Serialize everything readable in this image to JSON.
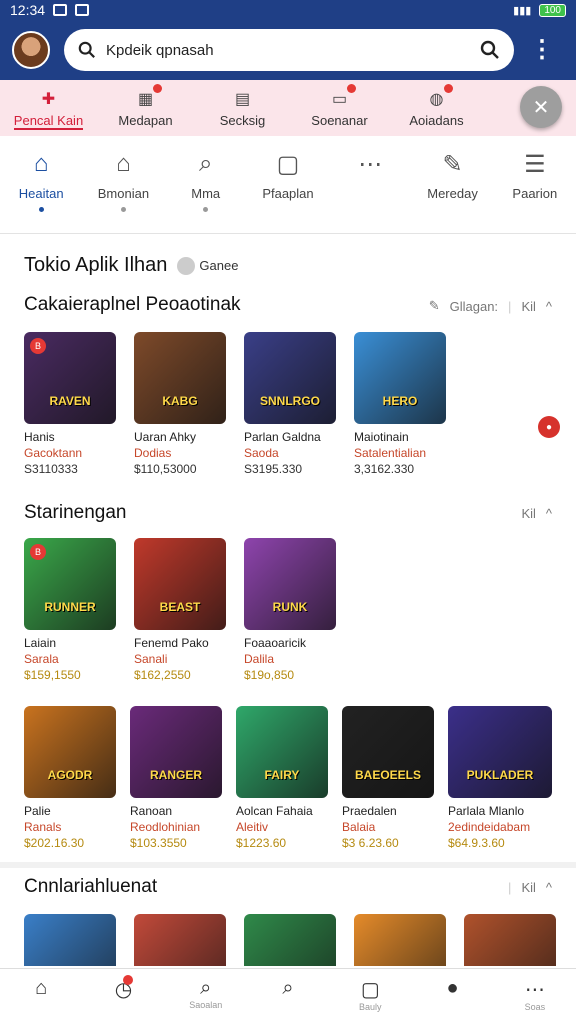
{
  "status": {
    "time": "12:34",
    "battery": "100"
  },
  "search": {
    "query": "Kpdeik qpnasah"
  },
  "categories": [
    {
      "label": "Pencal Kain",
      "icon": "puzzle-icon",
      "active": true,
      "badge": false
    },
    {
      "label": "Medapan",
      "icon": "calendar-icon",
      "active": false,
      "badge": true
    },
    {
      "label": "Secksig",
      "icon": "grid-icon",
      "active": false,
      "badge": false
    },
    {
      "label": "Soenanar",
      "icon": "monitor-icon",
      "active": false,
      "badge": true
    },
    {
      "label": "Aoiadans",
      "icon": "globe-icon",
      "active": false,
      "badge": true
    }
  ],
  "subnav": [
    {
      "label": "Heaitan",
      "icon": "home-icon",
      "active": true
    },
    {
      "label": "Bmonian",
      "icon": "house-icon",
      "active": false
    },
    {
      "label": "Mma",
      "icon": "search-icon",
      "active": false
    },
    {
      "label": "Pfaaplan",
      "icon": "chat-icon",
      "active": false
    },
    {
      "label": "",
      "icon": "more-icon",
      "active": false
    },
    {
      "label": "Mereday",
      "icon": "edit-icon",
      "active": false
    },
    {
      "label": "Paarion",
      "icon": "list-icon",
      "active": false
    }
  ],
  "main": {
    "title": "Tokio Aplik Ilhan",
    "title_badge": "Ganee"
  },
  "section1": {
    "title": "Cakaieraplnel Peoaotinak",
    "action": "Gllagan:",
    "more": "Kil",
    "items": [
      {
        "name": "Hanis",
        "sub": "Gacoktann",
        "price": "S3110333",
        "art": "RAVEN",
        "bg": "#4a2b62"
      },
      {
        "name": "Uaran Ahky",
        "sub": "Dodias",
        "price": "$110,53000",
        "art": "KABG",
        "bg": "#7e4a2a"
      },
      {
        "name": "Parlan Galdna",
        "sub": "Saoda",
        "price": "S3195.330",
        "art": "SNNLRGO",
        "bg": "#3a3f88"
      },
      {
        "name": "Maiotinain",
        "sub": "Satalentialian",
        "price": "3,3162.330",
        "art": "HERO",
        "bg": "#3a8fd6"
      }
    ]
  },
  "section2": {
    "title": "Starinengan",
    "more": "Kil",
    "items": [
      {
        "name": "Laiain",
        "sub": "Sarala",
        "price": "$159,1550",
        "art": "RUNNER",
        "bg": "#3aa84a"
      },
      {
        "name": "Fenemd Pako",
        "sub": "Sanali",
        "price": "$162,2550",
        "art": "BEAST",
        "bg": "#c0392b"
      },
      {
        "name": "Foaaoaricik",
        "sub": "Dalila",
        "price": "$19o,850",
        "art": "RUNK",
        "bg": "#8e44ad"
      }
    ],
    "items2": [
      {
        "name": "Palie",
        "sub": "Ranals",
        "price": "$202.16.30",
        "art": "AGODR",
        "bg": "#c9731f"
      },
      {
        "name": "Ranoan",
        "sub": "Reodlohinian",
        "price": "$103.3550",
        "art": "RANGER",
        "bg": "#6a2a7a"
      },
      {
        "name": "Aolcan Fahaia",
        "sub": "Aleitiv",
        "price": "$1223.60",
        "art": "FAIRY",
        "bg": "#2fa86a"
      },
      {
        "name": "Praedalen",
        "sub": "Balaia",
        "price": "$3 6.23.60",
        "art": "BAEOEELS",
        "bg": "#222"
      },
      {
        "name": "Parlala Mlanlo",
        "sub": "2edindeidabam",
        "price": "$64.9.3.60",
        "art": "PUKLADER",
        "bg": "#3b2f8a"
      }
    ]
  },
  "section3": {
    "title": "Cnnlariahluenat",
    "more": "Kil",
    "items": [
      {
        "bg": "#3a7fc8"
      },
      {
        "bg": "#c24a3a"
      },
      {
        "bg": "#2f8a4a"
      },
      {
        "bg": "#e58b2a"
      },
      {
        "bg": "#b0522c"
      }
    ]
  },
  "bottom_nav": [
    {
      "icon": "home-icon",
      "label": ""
    },
    {
      "icon": "clock-icon",
      "label": "",
      "badge": true
    },
    {
      "icon": "search-icon",
      "label": "Saoalan"
    },
    {
      "icon": "search-icon",
      "label": ""
    },
    {
      "icon": "chat-icon",
      "label": "Bauly"
    },
    {
      "icon": "person-icon",
      "label": ""
    },
    {
      "icon": "more-icon",
      "label": "Soas"
    }
  ]
}
